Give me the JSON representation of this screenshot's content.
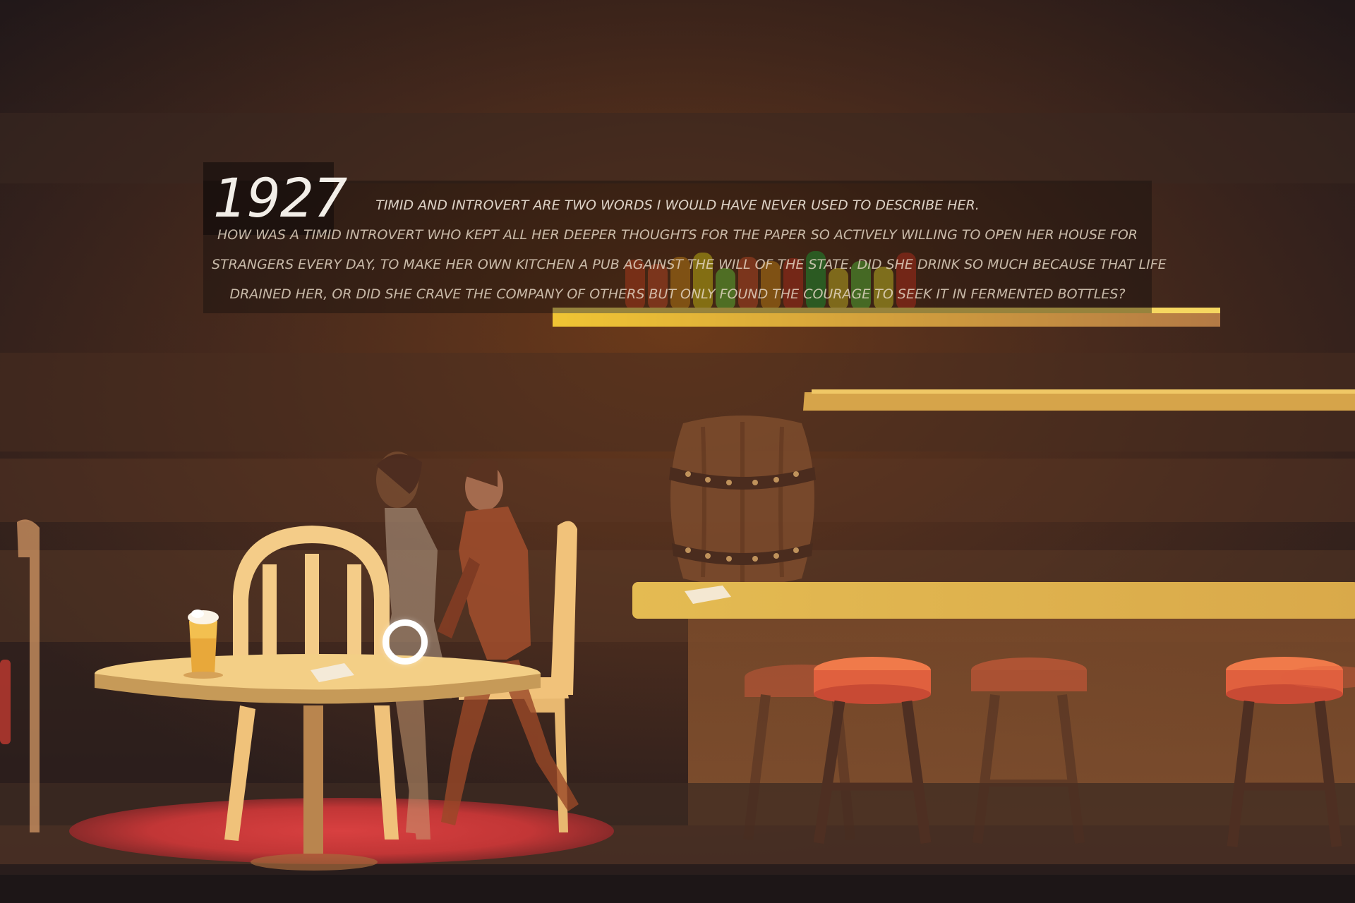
{
  "scene": {
    "year": "1927",
    "narration": [
      "TIMID AND INTROVERT ARE TWO WORDS I WOULD HAVE NEVER USED TO DESCRIBE HER.",
      "HOW WAS A TIMID INTROVERT WHO KEPT ALL HER DEEPER THOUGHTS FOR THE PAPER SO ACTIVELY WILLING TO OPEN HER HOUSE FOR",
      "STRANGERS EVERY DAY, TO MAKE HER OWN KITCHEN A PUB AGAINST THE WILL OF THE STATE. DID SHE DRINK SO MUCH BECAUSE THAT LIFE",
      "DRAINED HER, OR DID SHE CRAVE THE COMPANY OF OTHERS BUT ONLY FOUND THE COURAGE TO SEEK IT IN FERMENTED BOTTLES?"
    ]
  },
  "palette": {
    "wall_dark": "#2a1d18",
    "wall_warm": "#5a3623",
    "shelf": "#e8b84a",
    "counter": "#d9a94a",
    "stool_seat": "#e0603e",
    "rug": "#c23838",
    "chair": "#f1c27a"
  },
  "bottles": {
    "colors": [
      "#c94a20",
      "#d0542a",
      "#d98a1c",
      "#e0c21a",
      "#7cc23a",
      "#d0542a",
      "#d98a1c",
      "#c43a20",
      "#3a9c36",
      "#d8b828",
      "#6ab83a",
      "#d8c22a",
      "#c43a20"
    ]
  },
  "icons": [
    "hotspot-ring-icon"
  ]
}
